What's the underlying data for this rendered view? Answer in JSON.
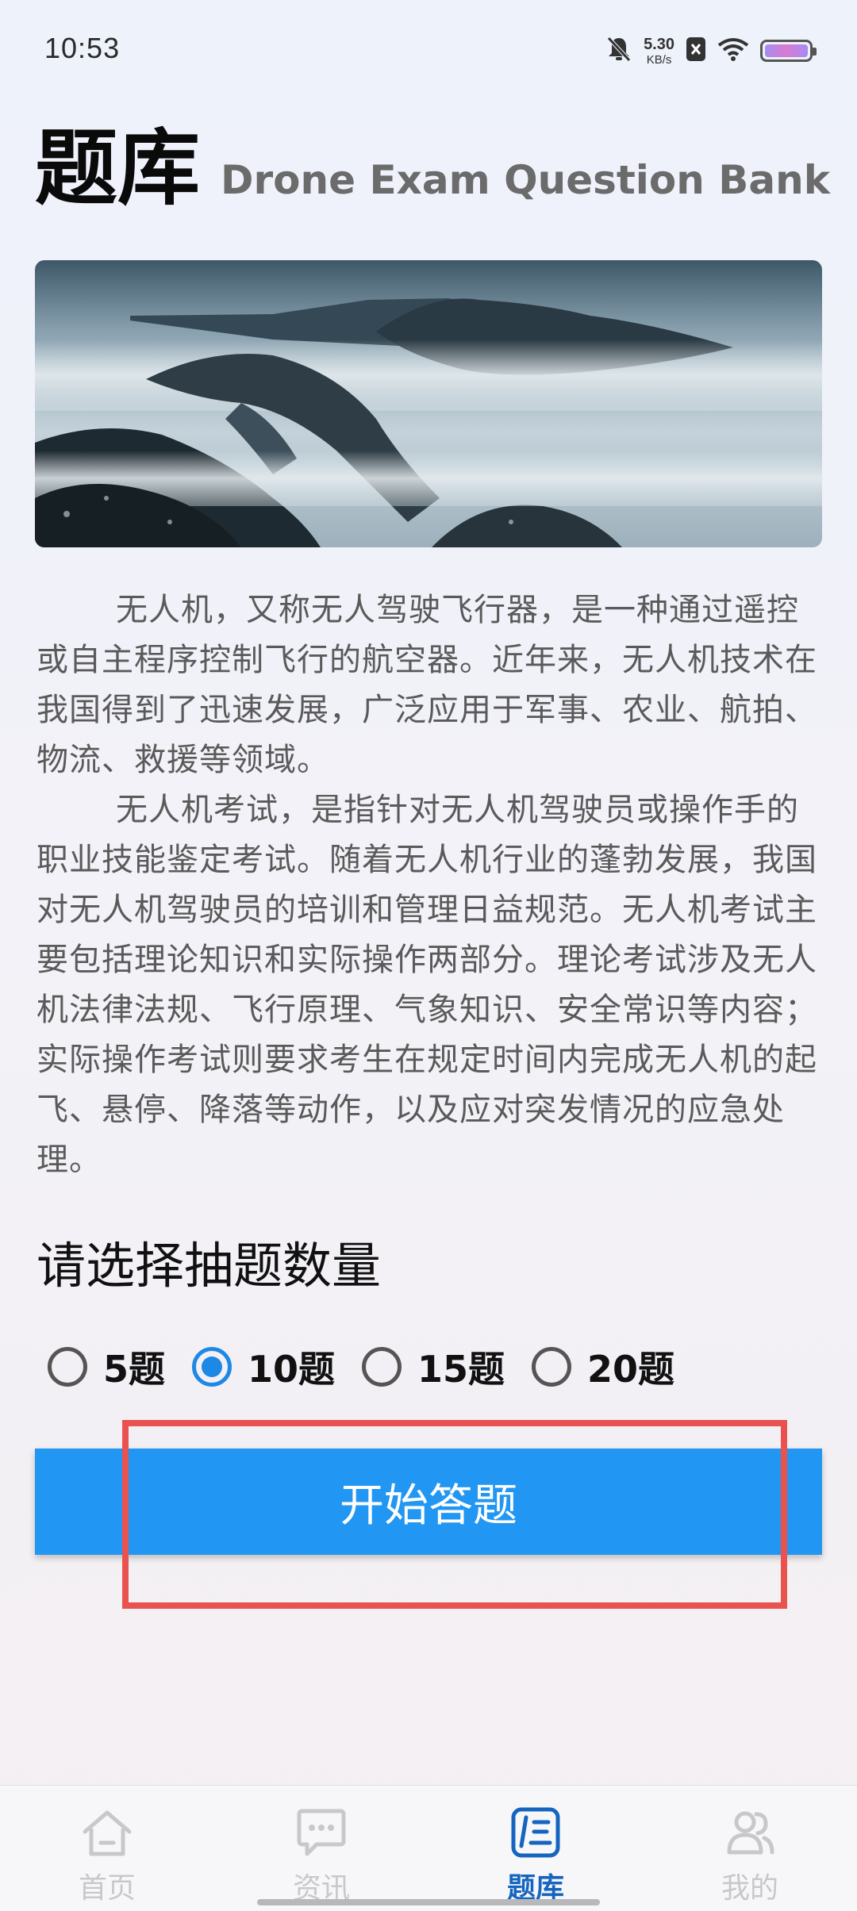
{
  "status_bar": {
    "time": "10:53",
    "net_speed_value": "5.30",
    "net_speed_unit": "KB/s",
    "icons": [
      "bell-muted-icon",
      "sim-x-icon",
      "wifi-icon",
      "battery-icon"
    ]
  },
  "header": {
    "title": "题库",
    "subtitle": "Drone Exam Question Bank"
  },
  "banner": {
    "icon": "landscape-image"
  },
  "intro": {
    "paragraph1": "无人机，又称无人驾驶飞行器，是一种通过遥控或自主程序控制飞行的航空器。近年来，无人机技术在我国得到了迅速发展，广泛应用于军事、农业、航拍、物流、救援等领域。",
    "paragraph2": "无人机考试，是指针对无人机驾驶员或操作手的职业技能鉴定考试。随着无人机行业的蓬勃发展，我国对无人机驾驶员的培训和管理日益规范。无人机考试主要包括理论知识和实际操作两部分。理论考试涉及无人机法律法规、飞行原理、气象知识、安全常识等内容；实际操作考试则要求考生在规定时间内完成无人机的起飞、悬停、降落等动作，以及应对突发情况的应急处理。"
  },
  "quiz": {
    "section_title": "请选择抽题数量",
    "options": [
      {
        "label": "5题",
        "selected": false
      },
      {
        "label": "10题",
        "selected": true
      },
      {
        "label": "15题",
        "selected": false
      },
      {
        "label": "20题",
        "selected": false
      }
    ],
    "start_label": "开始答题"
  },
  "colors": {
    "accent": "#2196f3",
    "radio_selected": "#1e88e5",
    "highlight": "#e8524f",
    "nav_active": "#1565c0",
    "nav_inactive": "#c8c8cc"
  },
  "bottom_nav": {
    "items": [
      {
        "label": "首页",
        "icon": "home-icon",
        "active": false
      },
      {
        "label": "资讯",
        "icon": "chat-icon",
        "active": false
      },
      {
        "label": "题库",
        "icon": "question-bank-icon",
        "active": true
      },
      {
        "label": "我的",
        "icon": "users-icon",
        "active": false
      }
    ]
  }
}
